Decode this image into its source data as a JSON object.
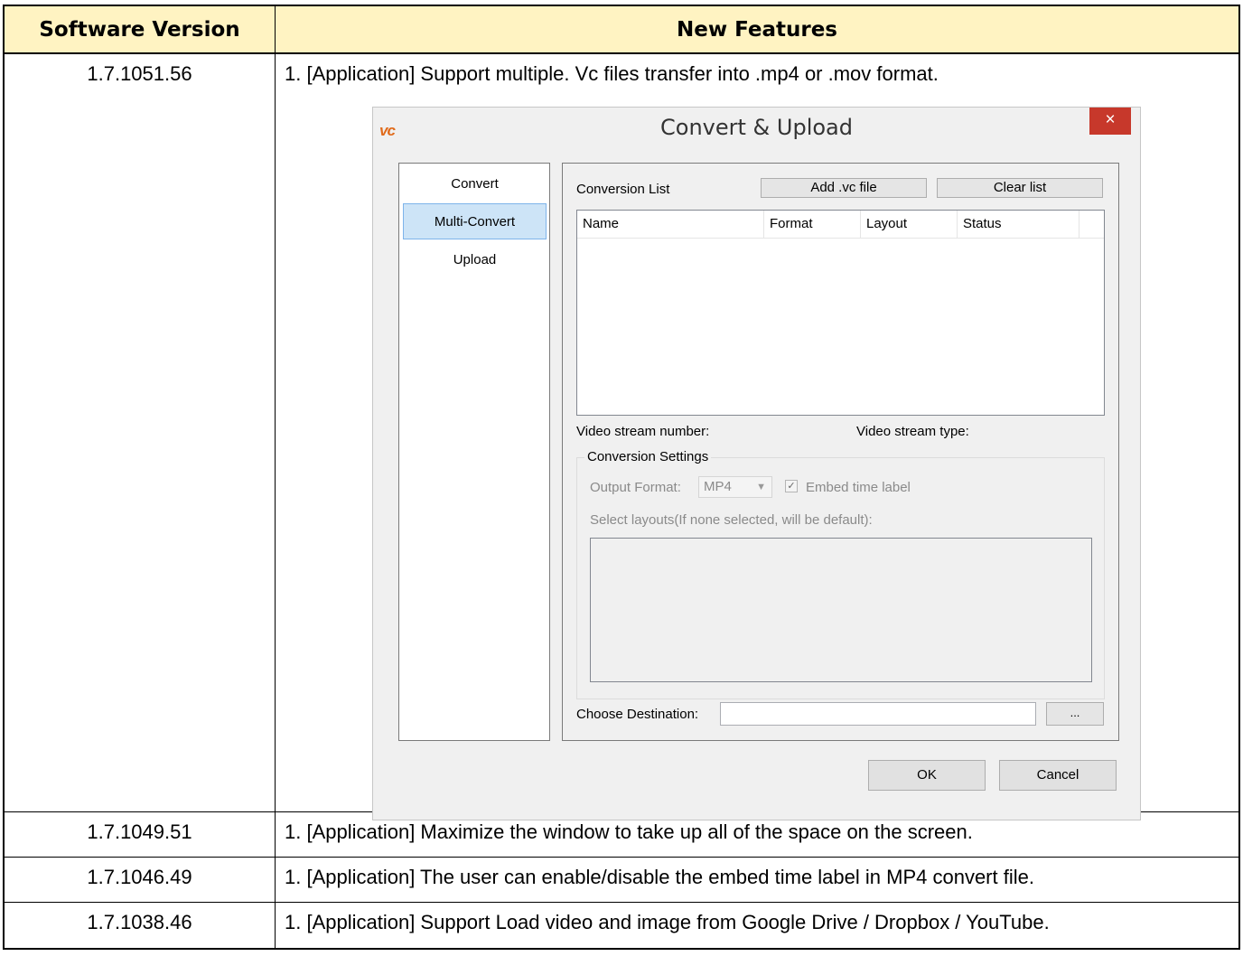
{
  "table": {
    "headers": {
      "version": "Software Version",
      "features": "New Features"
    },
    "rows": [
      {
        "version": "1.7.1051.56",
        "feature": "1. [Application] Support multiple. Vc files transfer into .mp4 or .mov format."
      },
      {
        "version": "1.7.1049.51",
        "feature": "1. [Application] Maximize the window to take up all of the space on the screen."
      },
      {
        "version": "1.7.1046.49",
        "feature": "1. [Application] The user can enable/disable the embed time label in MP4 convert file."
      },
      {
        "version": "1.7.1038.46",
        "feature": "1. [Application] Support Load video and image from Google Drive / Dropbox / YouTube."
      }
    ]
  },
  "dialog": {
    "logo": "vc",
    "title": "Convert & Upload",
    "close_icon": "×",
    "nav": [
      "Convert",
      "Multi-Convert",
      "Upload"
    ],
    "conversion_list_label": "Conversion List",
    "add_button": "Add .vc file",
    "clear_button": "Clear list",
    "columns": [
      "Name",
      "Format",
      "Layout",
      "Status"
    ],
    "stream_number_label": "Video stream number:",
    "stream_type_label": "Video stream type:",
    "settings_title": "Conversion Settings",
    "output_format_label": "Output Format:",
    "output_format_value": "MP4",
    "embed_label": "Embed time label",
    "checkmark": "✓",
    "layouts_label": "Select layouts(If none selected, will be default):",
    "destination_label": "Choose Destination:",
    "browse_button": "...",
    "ok_button": "OK",
    "cancel_button": "Cancel"
  }
}
